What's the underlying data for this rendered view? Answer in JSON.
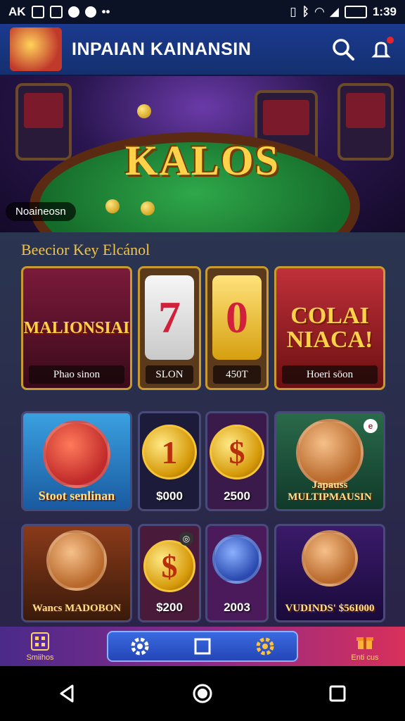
{
  "status_bar": {
    "left_label": "AK",
    "time": "1:39"
  },
  "header": {
    "title": "INPAIAN KAINANSIN",
    "logo_icon": "app-logo-icon",
    "search_icon": "search-icon",
    "notification_icon": "bell-icon"
  },
  "hero": {
    "title": "KALOS",
    "caption": "Noaineosn"
  },
  "section": {
    "title": "Beecior Key Elcánol"
  },
  "games": [
    {
      "art": "MALIONSIAI",
      "label": "Phao sinon"
    },
    {
      "art": "7",
      "label": "SLON"
    },
    {
      "art": "0",
      "label": "450T"
    },
    {
      "art": "COLAI NIACA!",
      "label": "Hoeri sōon"
    },
    {
      "art": "",
      "label": "Stoot senlinan"
    },
    {
      "art": "1",
      "label": "$000"
    },
    {
      "art": "$",
      "label": "2500"
    },
    {
      "art": "",
      "label": "Japauss MULTIPMAUSIN"
    },
    {
      "art": "",
      "label": "Wancs MADOBON"
    },
    {
      "art": "$",
      "label": "$200"
    },
    {
      "art": "",
      "label": "2003"
    },
    {
      "art": "",
      "label": "VUDINDS' $56I000"
    }
  ],
  "bottom_nav": {
    "left_label": "Smiihos",
    "right_label": "Enti cus"
  },
  "colors": {
    "header": "#1b3a8f",
    "gold": "#ffd24a",
    "nav_pill": "#3a6ae0"
  }
}
